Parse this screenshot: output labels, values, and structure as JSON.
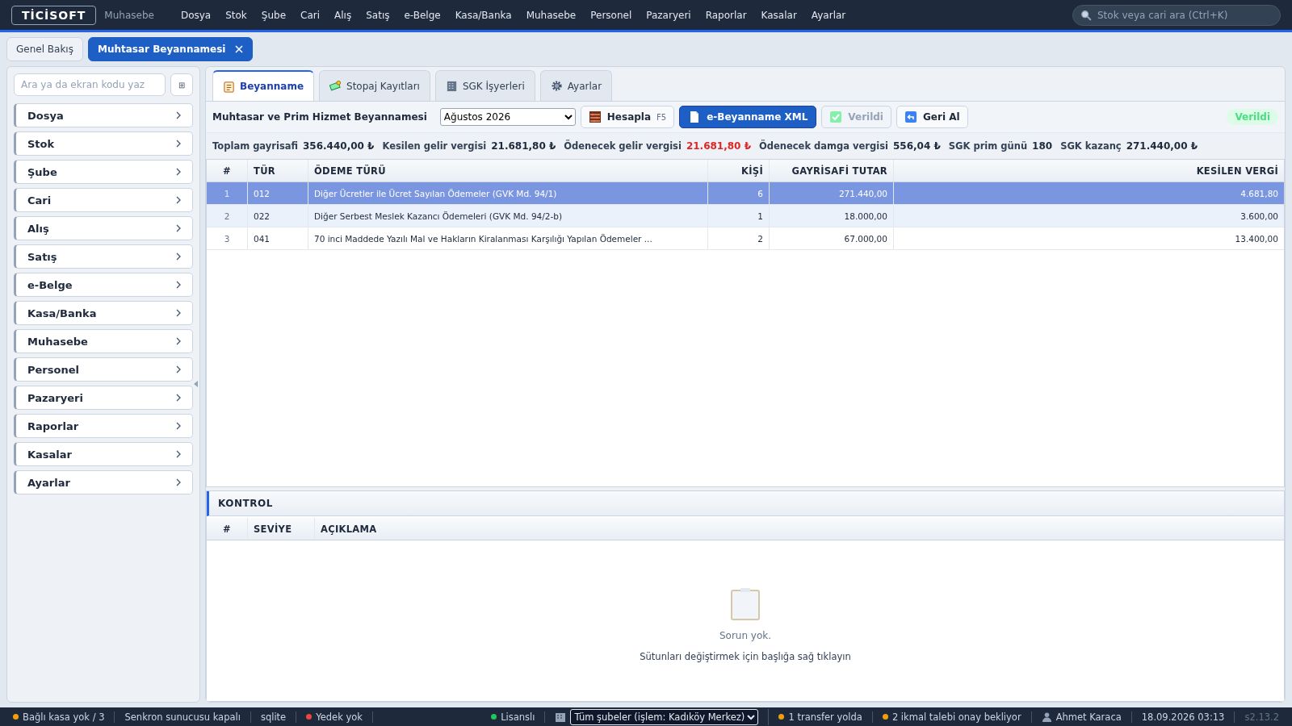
{
  "app": {
    "logo": "TİCİSOFT",
    "module": "Muhasebe"
  },
  "menu": [
    "Dosya",
    "Stok",
    "Şube",
    "Cari",
    "Alış",
    "Satış",
    "e-Belge",
    "Kasa/Banka",
    "Muhasebe",
    "Personel",
    "Pazaryeri",
    "Raporlar",
    "Kasalar",
    "Ayarlar"
  ],
  "global_search": {
    "placeholder": "Stok veya cari ara (Ctrl+K)"
  },
  "doc_tabs": [
    {
      "label": "Genel Bakış",
      "selected": false,
      "closable": false
    },
    {
      "label": "Muhtasar Beyannamesi",
      "selected": true,
      "closable": true
    }
  ],
  "sidebar": {
    "search": {
      "placeholder": "Ara ya da ekran kodu yaz"
    },
    "grid_button": "⊞",
    "items": [
      "Dosya",
      "Stok",
      "Şube",
      "Cari",
      "Alış",
      "Satış",
      "e-Belge",
      "Kasa/Banka",
      "Muhasebe",
      "Personel",
      "Pazaryeri",
      "Raporlar",
      "Kasalar",
      "Ayarlar"
    ]
  },
  "panel_tabs": [
    {
      "label": "Beyanname",
      "kind": "notepad",
      "selected": true
    },
    {
      "label": "Stopaj Kayıtları",
      "kind": "money",
      "selected": false
    },
    {
      "label": "SGK İşyerleri",
      "kind": "building",
      "selected": false
    },
    {
      "label": "Ayarlar",
      "kind": "gear",
      "selected": false
    }
  ],
  "toolbar": {
    "title": "Muhtasar ve Prim Hizmet Beyannamesi",
    "period": "Ağustos 2026",
    "buttons": [
      {
        "label": "Hesapla",
        "kind": "abacus",
        "shortcut": "F5",
        "primary": false,
        "disabled": false
      },
      {
        "label": "e-Beyanname XML",
        "kind": "document",
        "primary": true,
        "disabled": false
      },
      {
        "label": "Verildi",
        "kind": "check",
        "primary": false,
        "disabled": true
      },
      {
        "label": "Geri Al",
        "kind": "undo",
        "primary": false,
        "disabled": false
      }
    ],
    "status_badge": "Verildi"
  },
  "summary": [
    {
      "label": "Toplam gayrisafi",
      "value": "356.440,00 ₺",
      "alert": false
    },
    {
      "label": "Kesilen gelir vergisi",
      "value": "21.681,80 ₺",
      "alert": false
    },
    {
      "label": "Ödenecek gelir vergisi",
      "value": "21.681,80 ₺",
      "alert": true
    },
    {
      "label": "Ödenecek damga vergisi",
      "value": "556,04 ₺",
      "alert": false
    },
    {
      "label": "SGK prim günü",
      "value": "180",
      "alert": false
    },
    {
      "label": "SGK kazanç",
      "value": "271.440,00 ₺",
      "alert": false
    }
  ],
  "table": {
    "columns": [
      "#",
      "TÜR",
      "ÖDEME TÜRÜ",
      "KİŞİ",
      "GAYRİSAFİ TUTAR",
      "KESİLEN VERGİ"
    ],
    "rows": [
      {
        "cells": [
          "1",
          "012",
          "Diğer Ücretler ile Ücret Sayılan Ödemeler (GVK Md. 94/1)",
          "6",
          "271.440,00",
          "4.681,80"
        ],
        "selected": true
      },
      {
        "cells": [
          "2",
          "022",
          "Diğer Serbest Meslek Kazancı Ödemeleri (GVK Md. 94/2-b)",
          "1",
          "18.000,00",
          "3.600,00"
        ],
        "selected": false
      },
      {
        "cells": [
          "3",
          "041",
          "70 inci Maddede Yazılı Mal ve Hakların Kiralanması Karşılığı Yapılan Ödemeler ...",
          "2",
          "67.000,00",
          "13.400,00"
        ],
        "selected": false
      }
    ]
  },
  "control": {
    "title": "KONTROL",
    "columns": [
      "#",
      "SEVİYE",
      "AÇIKLAMA"
    ],
    "empty_message": "Sorun yok.",
    "hint": "Sütunları değiştirmek için başlığa sağ tıklayın"
  },
  "status_bar": {
    "left": [
      {
        "text": "Bağlı kasa yok / 3",
        "color": "#f59e0b"
      },
      {
        "text": "Senkron sunucusu kapalı"
      },
      {
        "text": "sqlite"
      },
      {
        "text": "Yedek yok",
        "color": "#ef4444"
      }
    ],
    "license": {
      "text": "Lisanslı",
      "color": "#22c55e"
    },
    "branch": "Tüm şubeler (işlem: Kadıköy Merkez)",
    "right": [
      {
        "text": "1 transfer yolda",
        "color": "#f59e0b"
      },
      {
        "text": "2 ikmal talebi onay bekliyor",
        "color": "#f59e0b"
      }
    ],
    "user": "Ahmet Karaca",
    "datetime": "18.09.2026 03:13",
    "version": "s2.13.2"
  }
}
